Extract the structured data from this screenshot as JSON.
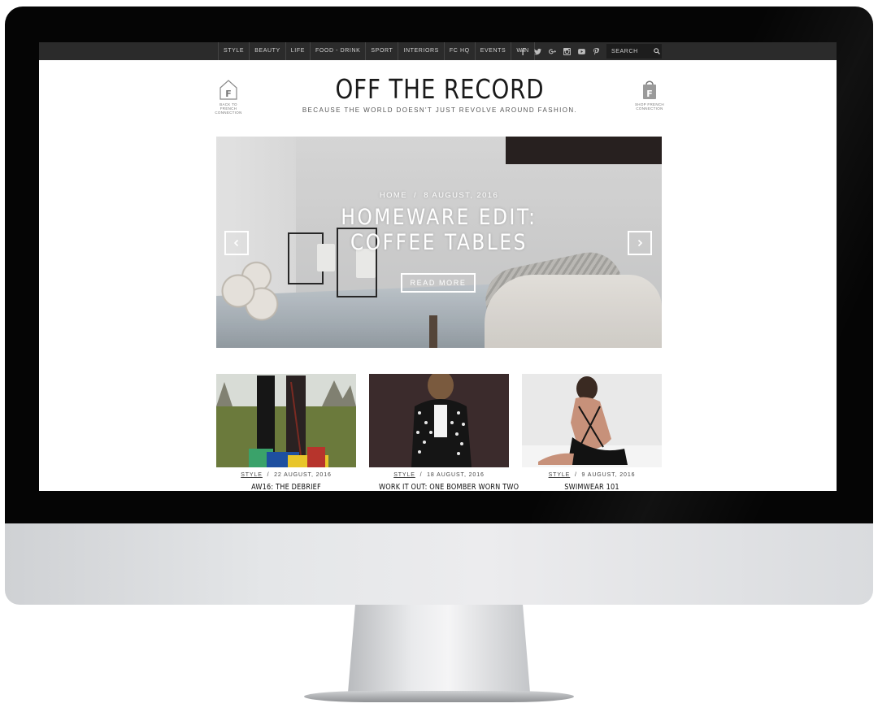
{
  "nav": {
    "items": [
      {
        "label": "STYLE"
      },
      {
        "label": "BEAUTY"
      },
      {
        "label": "LIFE"
      },
      {
        "label": "FOOD - DRINK"
      },
      {
        "label": "SPORT"
      },
      {
        "label": "INTERIORS"
      },
      {
        "label": "FC HQ"
      },
      {
        "label": "EVENTS"
      },
      {
        "label": "WIN"
      }
    ],
    "social_icons": [
      "facebook-icon",
      "twitter-icon",
      "google-plus-icon",
      "instagram-icon",
      "youtube-icon",
      "pinterest-icon"
    ],
    "search_placeholder": "SEARCH"
  },
  "header": {
    "title": "OFF THE RECORD",
    "tagline": "BECAUSE THE WORLD DOESN'T JUST REVOLVE AROUND FASHION.",
    "left_link_caption": "BACK TO FRENCH CONNECTION",
    "right_link_caption": "SHOP FRENCH CONNECTION"
  },
  "hero": {
    "breadcrumb_home": "HOME",
    "separator": "/",
    "date": "8 AUGUST, 2016",
    "title": "HOMEWARE EDIT: COFFEE TABLES",
    "button_label": "READ MORE"
  },
  "posts": [
    {
      "category": "STYLE",
      "date": "22 AUGUST, 2016",
      "title": "AW16: THE DEBRIEF"
    },
    {
      "category": "STYLE",
      "date": "18 AUGUST, 2016",
      "title": "WORK IT OUT: ONE BOMBER WORN TWO"
    },
    {
      "category": "STYLE",
      "date": "9 AUGUST, 2016",
      "title": "SWIMWEAR 101"
    }
  ],
  "colors": {
    "nav_bg": "#2b2b2b",
    "text_dark": "#1a1a1a",
    "bezel": "#050505"
  }
}
